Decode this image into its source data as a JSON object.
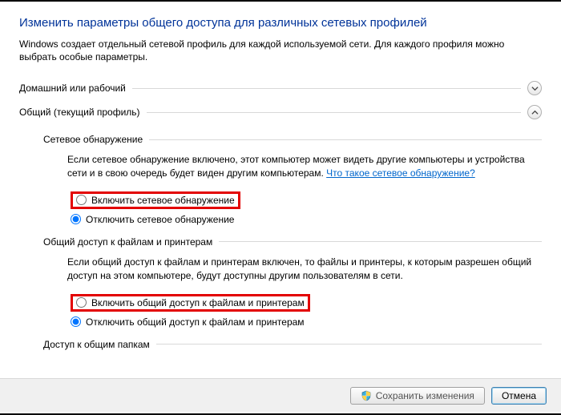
{
  "title": "Изменить параметры общего доступа для различных сетевых профилей",
  "intro": "Windows создает отдельный сетевой профиль для каждой используемой сети. Для каждого профиля можно выбрать особые параметры.",
  "sections": {
    "home": {
      "title": "Домашний или рабочий"
    },
    "public": {
      "title": "Общий (текущий профиль)"
    }
  },
  "network_discovery": {
    "group_title": "Сетевое обнаружение",
    "desc": "Если сетевое обнаружение включено, этот компьютер может видеть другие компьютеры и устройства сети и в свою очередь будет виден другим компьютерам. ",
    "link": "Что такое сетевое обнаружение?",
    "enable_label": "Включить сетевое обнаружение",
    "disable_label": "Отключить сетевое обнаружение"
  },
  "file_sharing": {
    "group_title": "Общий доступ к файлам и принтерам",
    "desc": "Если общий доступ к файлам и принтерам включен, то файлы и принтеры, к которым разрешен общий доступ на этом компьютере, будут доступны другим пользователям в сети.",
    "enable_label": "Включить общий доступ к файлам и принтерам",
    "disable_label": "Отключить общий доступ к файлам и принтерам"
  },
  "public_folder": {
    "group_title": "Доступ к общим папкам"
  },
  "buttons": {
    "save": "Сохранить изменения",
    "cancel": "Отмена"
  }
}
